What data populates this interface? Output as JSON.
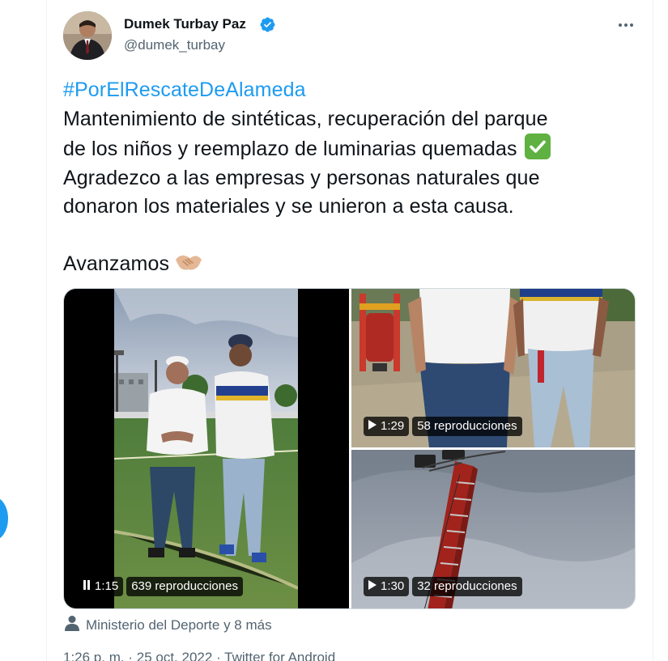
{
  "author": {
    "name": "Dumek Turbay Paz",
    "handle": "@dumek_turbay",
    "verified_color": "#1d9bf0"
  },
  "tweet": {
    "hashtag": "#PorElRescateDeAlameda",
    "line1": "Mantenimiento de sintéticas, recuperación del parque",
    "line2": "de los niños y reemplazo de luminarias quemadas",
    "line3": "Agradezco a las empresas y personas naturales que",
    "line4": "donaron los materiales y se unieron a esta causa.",
    "line5": "Avanzamos",
    "emoji_1": "check-mark-button",
    "emoji_2": "handshake"
  },
  "media": [
    {
      "state": "pause",
      "duration": "1:15",
      "views": "639 reproducciones"
    },
    {
      "state": "play",
      "duration": "1:29",
      "views": "58 reproducciones"
    },
    {
      "state": "play",
      "duration": "1:30",
      "views": "32 reproducciones"
    }
  ],
  "tagged": {
    "text": "Ministerio del Deporte y 8 más"
  },
  "footer": {
    "time": "1:26 p. m.",
    "separator": "·",
    "date": "25 oct. 2022",
    "source": "Twitter for Android"
  },
  "colors": {
    "accent": "#1d9bf0",
    "text": "#0f1419",
    "secondary": "#536471"
  }
}
